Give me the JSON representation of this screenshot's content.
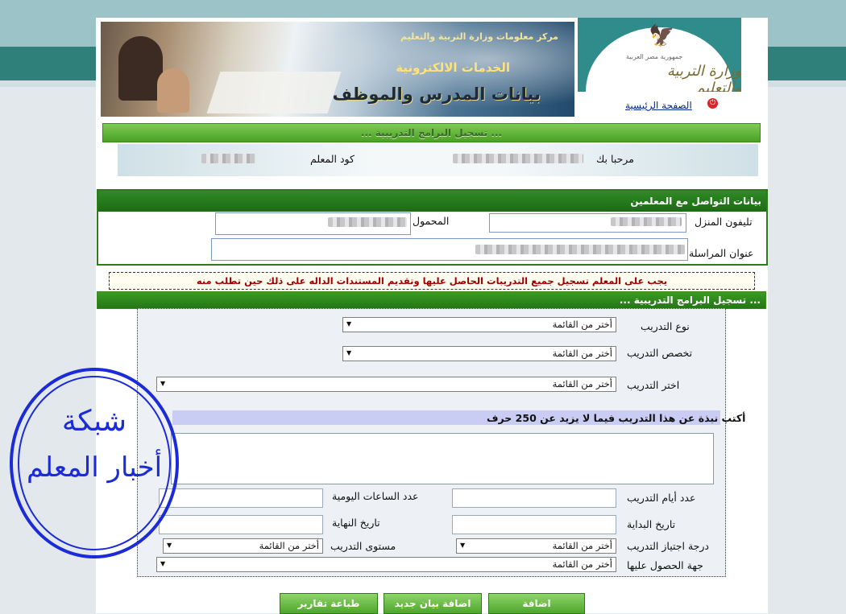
{
  "header": {
    "banner_org": "مركز معلومات وزارة التربية والتعليم",
    "banner_service": "الخدمات الالكترونية",
    "banner_title": "بيانات المدرس والموظف",
    "logo_caption": "جمهورية مصر العربية",
    "logo_ministry": "وزارة التربية والتعليم",
    "home_link": "الصفحة الرئيسية"
  },
  "top_section": {
    "title": "... تسجيل البرامج التدريبية ...",
    "welcome_label": "مرحبا بك",
    "teacher_code_label": "كود المعلم"
  },
  "contact": {
    "title": "بيانات التواصل مع المعلمين",
    "home_phone_label": "تليفون المنزل",
    "mobile_label": "المحمول",
    "address_label": "عنوان المراسلة"
  },
  "notice": "يجب على المعلم تسجيل جميع التدريبات الحاصل عليها وتقديم المستندات الداله على ذلك حين تطلب منه",
  "training": {
    "title": "... تسجيل البرامج التدريبية ...",
    "type_label": "نوع التدريب",
    "specialty_label": "تخصص التدريب",
    "choose_label": "اختر التدريب",
    "select_placeholder": "أختر من القائمة",
    "brief_label": "أكتب نبذة عن هذا التدريب فيما لا يزيد عن 250 حرف",
    "days_label": "عدد أيام التدريب",
    "hours_label": "عدد الساعات اليومية",
    "start_label": "تاريخ البداية",
    "end_label": "تاريخ النهاية",
    "grade_label": "درجة اجتياز التدريب",
    "level_label": "مستوى التدريب",
    "source_label": "جهة الحصول عليها"
  },
  "buttons": {
    "add": "اضافة",
    "add_new": "اضافة بيان جديد",
    "print": "طباعة تقارير"
  },
  "watermark": {
    "line1": "شبكة",
    "line2": "أخبار المعلم"
  },
  "colors": {
    "green_bar": "#4aa124",
    "dark_green": "#1e6a16",
    "notice_text": "#a00000",
    "stamp_blue": "#1c2bd8",
    "teal": "#2f7f7b"
  }
}
